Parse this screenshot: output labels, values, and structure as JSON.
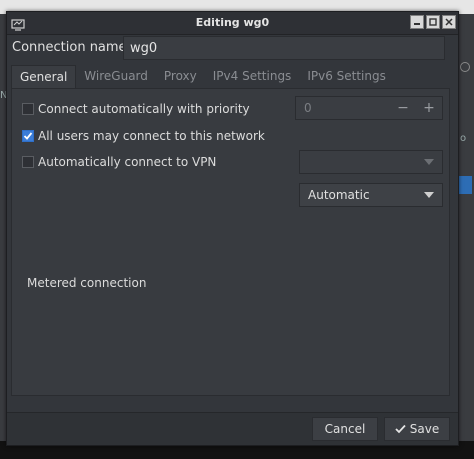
{
  "window": {
    "title": "Editing wg0"
  },
  "connection": {
    "label": "Connection name",
    "value": "wg0"
  },
  "tabs": [
    {
      "label": "General",
      "active": true
    },
    {
      "label": "WireGuard"
    },
    {
      "label": "Proxy"
    },
    {
      "label": "IPv4 Settings"
    },
    {
      "label": "IPv6 Settings"
    }
  ],
  "general": {
    "auto_connect": {
      "label": "Connect automatically with priority",
      "checked": false
    },
    "priority": {
      "value": "0",
      "minus": "−",
      "plus": "+"
    },
    "all_users": {
      "label": "All users may connect to this network",
      "checked": true
    },
    "auto_vpn": {
      "label": "Automatically connect to VPN",
      "checked": false,
      "vpn_value": ""
    },
    "metered": {
      "label": "Metered connection",
      "value": "Automatic"
    }
  },
  "footer": {
    "cancel": "Cancel",
    "save": "Save"
  },
  "background": {
    "frag_n": "N",
    "frag_o": "o"
  },
  "colors": {
    "accent": "#3b7dd8",
    "window_bg": "#33363b",
    "panel_bg": "#383b40"
  }
}
